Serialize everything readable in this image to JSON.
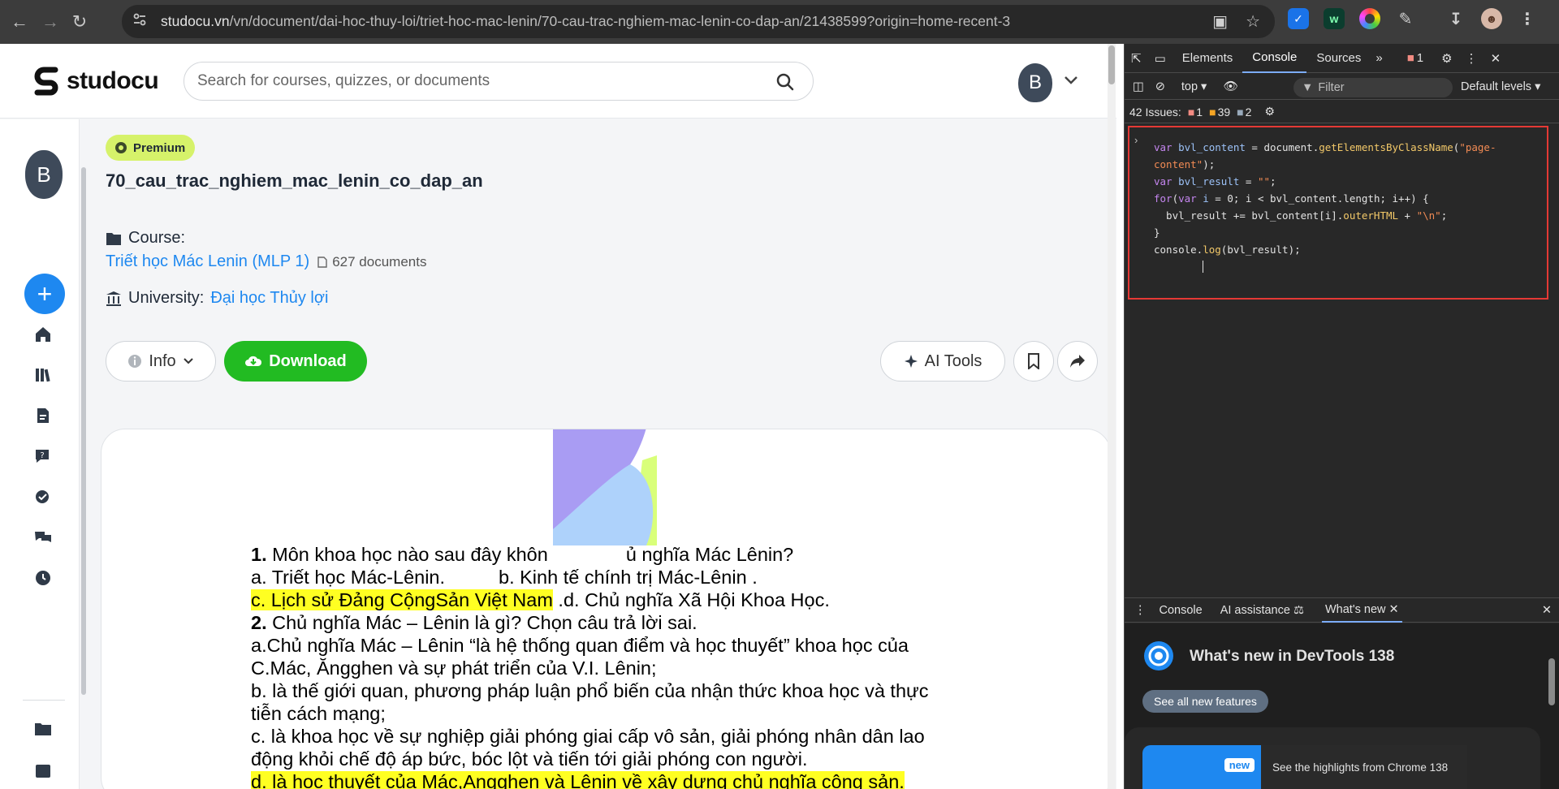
{
  "browser": {
    "url_host": "studocu.vn",
    "url_path": "/vn/document/dai-hoc-thuy-loi/triet-hoc-mac-lenin/70-cau-trac-nghiem-mac-lenin-co-dap-an/21438599?origin=home-recent-3"
  },
  "site": {
    "logo_text": "studocu",
    "search_placeholder": "Search for courses, quizzes, or documents",
    "avatar_letter": "B"
  },
  "sidebar": {
    "avatar_letter": "B",
    "add_label": "+"
  },
  "document": {
    "badge": "Premium",
    "title": "70_cau_trac_nghiem_mac_lenin_co_dap_an",
    "course_label": "Course:",
    "course_name": "Triết học Mác Lenin (MLP 1)",
    "course_docs": "627 documents",
    "university_label": "University:",
    "university_name": "Đại học Thủy lợi"
  },
  "actions": {
    "info": "Info",
    "download": "Download",
    "ai_tools": "AI Tools"
  },
  "content": {
    "q1_num": "1.",
    "q1_text": " Môn khoa học nào sau đây khôn",
    "q1_text_end": "ủ nghĩa Mác Lênin?",
    "q1_a": "a. Triết học Mác-Lênin.",
    "q1_b": "b. Kinh tế chính trị Mác-Lênin .",
    "q1_c": "c. Lịch sử Đảng CộngSản Việt Nam",
    "q1_d": " .d. Chủ nghĩa Xã Hội Khoa Học.",
    "q2_num": "2.",
    "q2_text": " Chủ nghĩa Mác – Lênin là gì? Chọn câu trả lời sai.",
    "q2_a1": "a.Chủ nghĩa Mác – Lênin “là hệ thống quan điểm và học thuyết” khoa học của",
    "q2_a2": "C.Mác, Ăngghen và sự phát triển của V.I. Lênin;",
    "q2_b1": "b. là thế giới quan, phương pháp luận phổ biến của nhận thức khoa học và thực",
    "q2_b2": "tiễn cách mạng;",
    "q2_c1": "c. là khoa học về sự nghiệp giải phóng giai cấp vô sản, giải phóng nhân dân lao",
    "q2_c2": "động khỏi chế độ áp bức, bóc lột và tiến tới giải phóng con người.",
    "q2_d": "d. là học thuyết của Mác,Angghen và Lênin về xây dựng chủ nghĩa cộng sản."
  },
  "devtools": {
    "tabs": [
      "Elements",
      "Console",
      "Sources"
    ],
    "error_count": "1",
    "context": "top",
    "filter_placeholder": "Filter",
    "levels": "Default levels",
    "issues_label": "42 Issues:",
    "issues_errors": "1",
    "issues_warnings": "39",
    "issues_info": "2",
    "drawer_tabs": [
      "Console",
      "AI assistance",
      "What's new"
    ],
    "whats_new_title": "What's new in DevTools 138",
    "see_all": "See all new features",
    "new_badge": "new",
    "highlight_text": "See the highlights from Chrome 138"
  },
  "colors": {
    "accent_blue": "#1e88f0",
    "download_green": "#22bb22",
    "premium_lime": "#d6f26a",
    "highlight_yellow": "#ffff22",
    "devtools_bg": "#282828",
    "red_outline": "#e53935"
  }
}
